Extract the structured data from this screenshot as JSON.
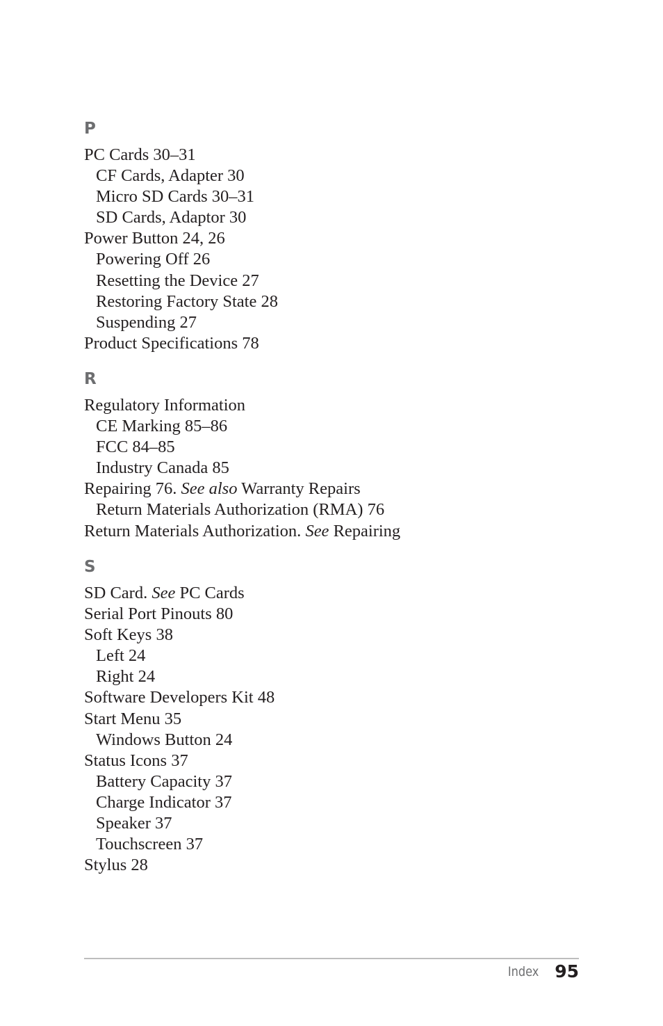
{
  "sections": [
    {
      "letter": "P",
      "entries": [
        {
          "level": 0,
          "text": "PC Cards  30–31"
        },
        {
          "level": 1,
          "text": "CF Cards, Adapter  30"
        },
        {
          "level": 1,
          "text": "Micro SD Cards  30–31"
        },
        {
          "level": 1,
          "text": "SD Cards, Adaptor  30"
        },
        {
          "level": 0,
          "text": "Power Button  24, 26"
        },
        {
          "level": 1,
          "text": "Powering Off  26"
        },
        {
          "level": 1,
          "text": "Resetting the Device  27"
        },
        {
          "level": 1,
          "text": "Restoring Factory State  28"
        },
        {
          "level": 1,
          "text": "Suspending  27"
        },
        {
          "level": 0,
          "text": "Product Specifications  78"
        }
      ]
    },
    {
      "letter": "R",
      "entries": [
        {
          "level": 0,
          "text": "Regulatory Information"
        },
        {
          "level": 1,
          "text": "CE Marking  85–86"
        },
        {
          "level": 1,
          "text": "FCC  84–85"
        },
        {
          "level": 1,
          "text": "Industry Canada  85"
        },
        {
          "level": 0,
          "text": "Repairing  76. ",
          "see": "See also",
          "after": " Warranty Repairs"
        },
        {
          "level": 1,
          "text": "Return Materials Authorization (RMA)  76"
        },
        {
          "level": 0,
          "text": "Return Materials Authorization. ",
          "see": "See",
          "after": " Repairing"
        }
      ]
    },
    {
      "letter": "S",
      "entries": [
        {
          "level": 0,
          "text": "SD Card. ",
          "see": "See",
          "after": " PC Cards"
        },
        {
          "level": 0,
          "text": "Serial Port Pinouts  80"
        },
        {
          "level": 0,
          "text": "Soft Keys  38"
        },
        {
          "level": 1,
          "text": "Left  24"
        },
        {
          "level": 1,
          "text": "Right  24"
        },
        {
          "level": 0,
          "text": "Software Developers Kit  48"
        },
        {
          "level": 0,
          "text": "Start Menu  35"
        },
        {
          "level": 1,
          "text": "Windows Button  24"
        },
        {
          "level": 0,
          "text": "Status Icons  37"
        },
        {
          "level": 1,
          "text": "Battery Capacity  37"
        },
        {
          "level": 1,
          "text": "Charge Indicator  37"
        },
        {
          "level": 1,
          "text": "Speaker  37"
        },
        {
          "level": 1,
          "text": "Touchscreen  37"
        },
        {
          "level": 0,
          "text": "Stylus  28"
        }
      ]
    }
  ],
  "footer": {
    "label": "Index",
    "page_number": "95"
  }
}
